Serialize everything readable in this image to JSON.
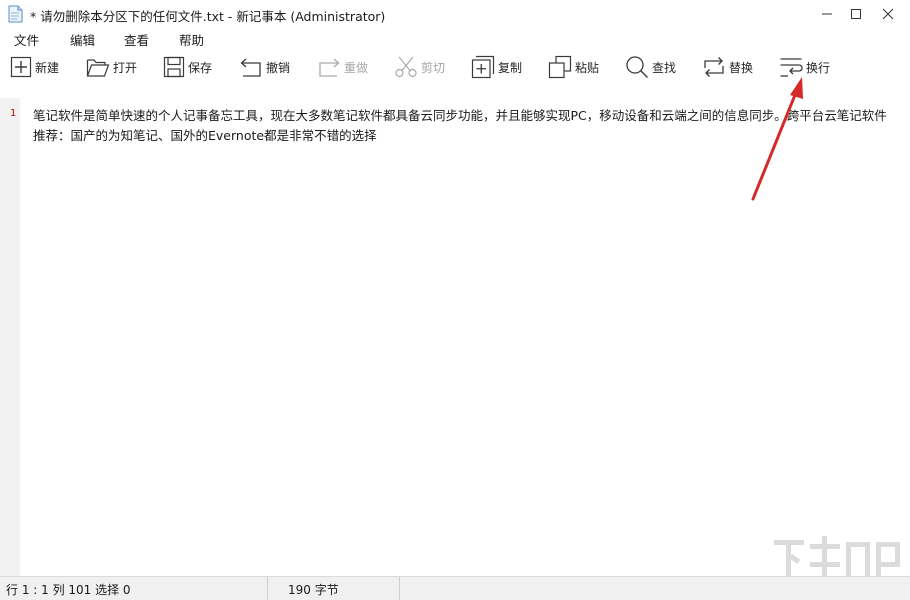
{
  "window": {
    "title": "* 请勿删除本分区下的任何文件.txt - 新记事本 (Administrator)"
  },
  "menu": [
    {
      "label": "文件"
    },
    {
      "label": "编辑"
    },
    {
      "label": "查看"
    },
    {
      "label": "帮助"
    }
  ],
  "toolbar": {
    "new": "新建",
    "open": "打开",
    "save": "保存",
    "undo": "撤销",
    "redo": "重做",
    "cut": "剪切",
    "copy": "复制",
    "paste": "粘贴",
    "find": "查找",
    "replace": "替换",
    "wrap": "换行"
  },
  "editor": {
    "line_number": "1",
    "text": "笔记软件是简单快速的个人记事备忘工具，现在大多数笔记软件都具备云同步功能，并且能够实现PC，移动设备和云端之间的信息同步。跨平台云笔记软件推荐：国产的为知笔记、国外的Evernote都是非常不错的选择"
  },
  "status": {
    "position": "行 1 : 1   列 101   选择 0",
    "bytes": "190 字节"
  },
  "colors": {
    "line_number": "#c00000",
    "annotation_arrow": "#d42a2a",
    "disabled_text": "#a6a6a6"
  }
}
